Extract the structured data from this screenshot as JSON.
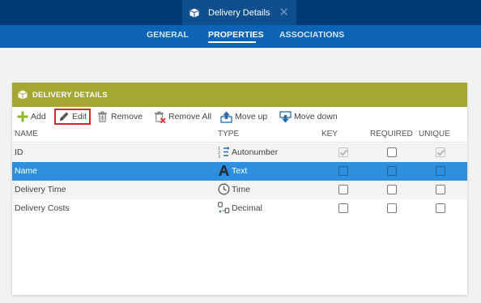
{
  "document_tab": {
    "title": "Delivery Details",
    "icon": "box-icon",
    "close_icon": "close-icon"
  },
  "nav": {
    "items": [
      "GENERAL",
      "PROPERTIES",
      "ASSOCIATIONS"
    ],
    "active": "PROPERTIES"
  },
  "panel": {
    "title": "DELIVERY DETAILS",
    "icon": "box-icon",
    "header_color": "#a4a833"
  },
  "toolbar": {
    "add": "Add",
    "edit": "Edit",
    "remove": "Remove",
    "remove_all": "Remove All",
    "move_up": "Move up",
    "move_down": "Move down"
  },
  "table": {
    "headers": {
      "name": "NAME",
      "type": "TYPE",
      "key": "KEY",
      "required": "REQUIRED",
      "unique": "UNIQUE"
    },
    "rows": [
      {
        "name": "ID",
        "type": "Autonumber",
        "type_icon": "autonumber-icon",
        "key": true,
        "key_disabled": true,
        "required": false,
        "unique": true,
        "unique_disabled": true,
        "selected": false
      },
      {
        "name": "Name",
        "type": "Text",
        "type_icon": "text-type-icon",
        "key": false,
        "required": false,
        "unique": false,
        "selected": true
      },
      {
        "name": "Delivery Time",
        "type": "Time",
        "type_icon": "clock-icon",
        "key": false,
        "required": false,
        "unique": false,
        "selected": false
      },
      {
        "name": "Delivery Costs",
        "type": "Decimal",
        "type_icon": "decimal-icon",
        "key": false,
        "required": false,
        "unique": false,
        "selected": false
      }
    ]
  },
  "colors": {
    "topbar": "#003a75",
    "subnav": "#0b64b5",
    "selection": "#2e8fde",
    "edit_highlight": "#d9262d"
  }
}
